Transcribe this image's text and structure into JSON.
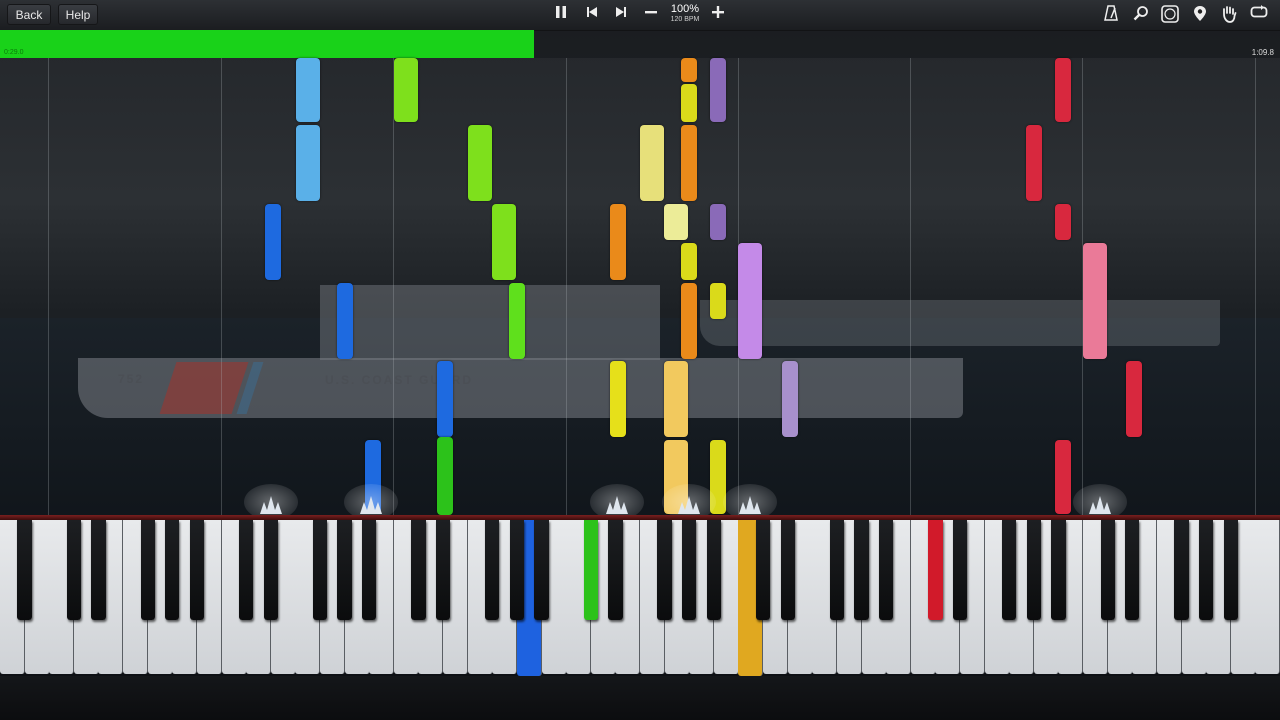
{
  "toolbar": {
    "back_label": "Back",
    "help_label": "Help",
    "tempo_percent": "100%",
    "tempo_bpm": "120 BPM",
    "icons": [
      "pause-icon",
      "previous-icon",
      "next-icon",
      "minus-icon",
      "plus-icon",
      "metronome-icon",
      "zoom-icon",
      "label-icon",
      "marker-icon",
      "hand-icon",
      "loop-icon"
    ]
  },
  "background": {
    "ship_hull_number": "752",
    "ship_name": "U.S. COAST GUARD"
  },
  "playback": {
    "elapsed_time": "0:29.0",
    "total_time": "1:09.8",
    "progress_fraction": 0.417,
    "progress_color": "#19d219"
  },
  "keyboard": {
    "white_key_count": 52,
    "pressed_keys": [
      {
        "note": "A3",
        "color": "#1e62e0"
      },
      {
        "note": "C#4",
        "color": "#2cc21a"
      },
      {
        "note": "C5",
        "color": "#e0a820"
      },
      {
        "note": "C#6",
        "color": "#d11a2a"
      }
    ]
  },
  "colors": {
    "light_blue": "#5ab0e8",
    "blue": "#1e6ae0",
    "lime": "#7ee01c",
    "green": "#2cc21a",
    "orange": "#ea8a1a",
    "yellow": "#dada1a",
    "pale_yellow": "#e7e07a",
    "gold": "#f2c95e",
    "violet": "#8a6ab8",
    "lilac": "#c48ae8",
    "red": "#d8283e",
    "pink": "#ea7a98"
  }
}
